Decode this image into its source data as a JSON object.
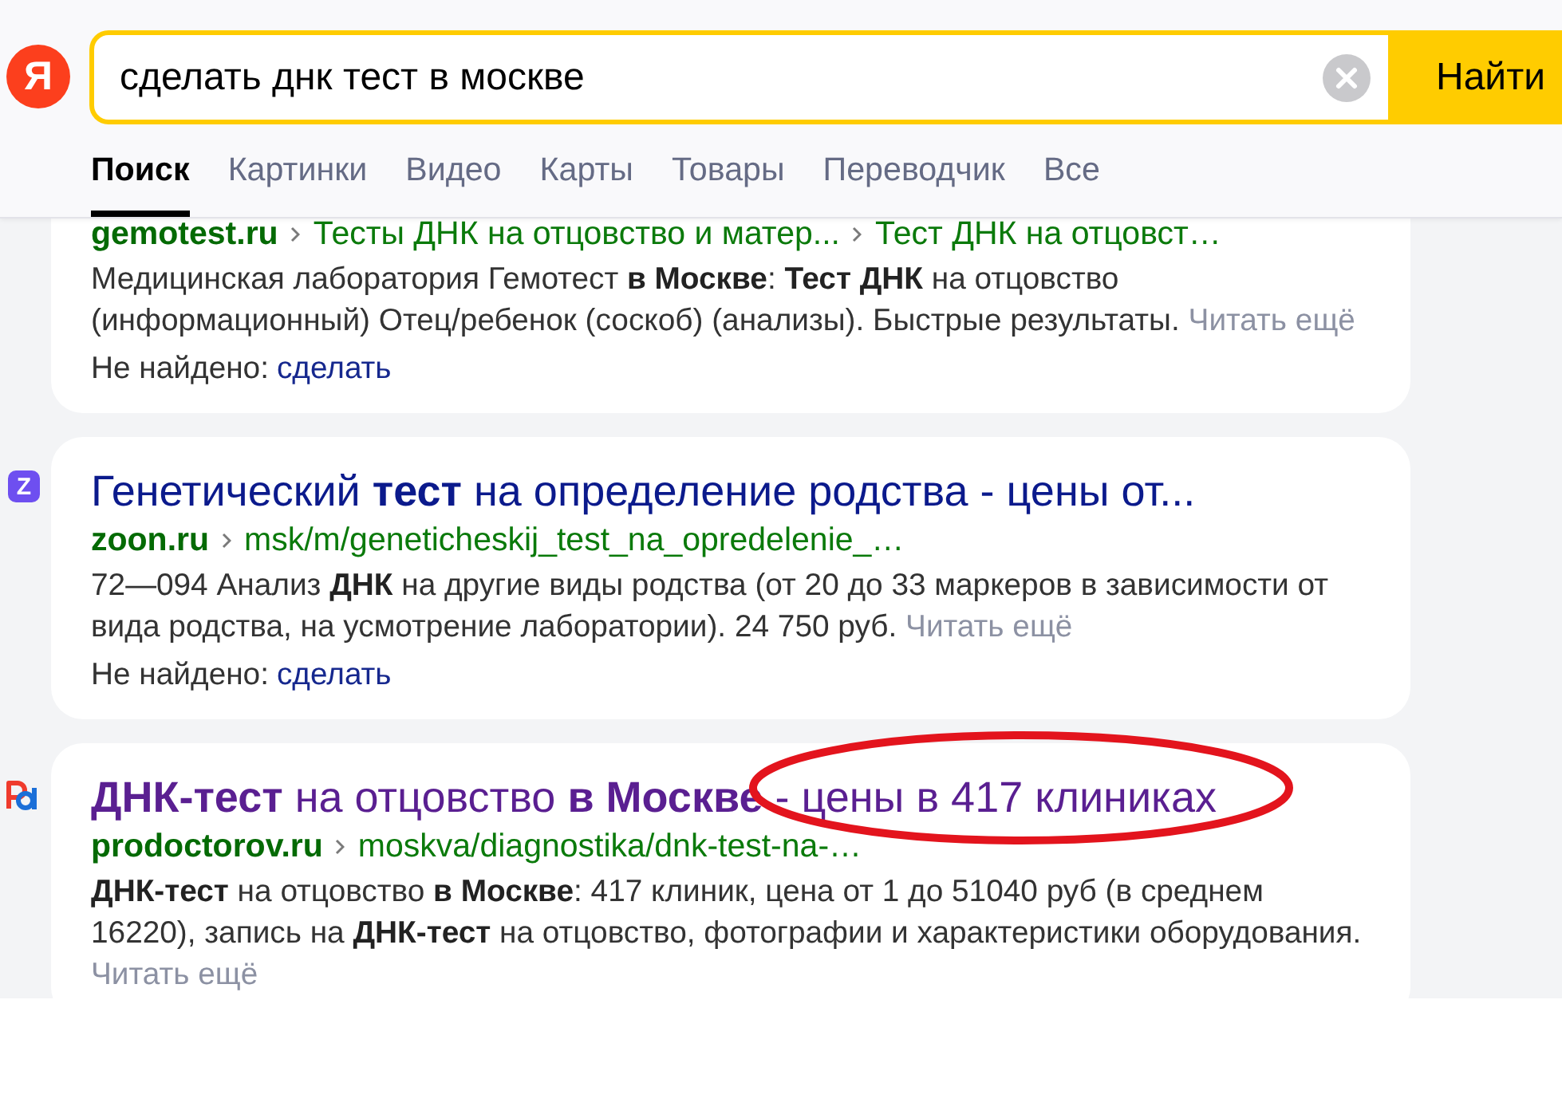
{
  "header": {
    "logo": "Я",
    "search": {
      "value": "сделать днк тест в москве",
      "button": "Найти"
    }
  },
  "tabs": [
    {
      "label": "Поиск",
      "selected": true
    },
    {
      "label": "Картинки",
      "selected": false
    },
    {
      "label": "Видео",
      "selected": false
    },
    {
      "label": "Карты",
      "selected": false
    },
    {
      "label": "Товары",
      "selected": false
    },
    {
      "label": "Переводчик",
      "selected": false
    },
    {
      "label": "Все",
      "selected": false
    }
  ],
  "results": [
    {
      "url": {
        "domain": "gemotest.ru",
        "path": [
          "Тесты ДНК на отцовство и матер...",
          "Тест ДНК на отцовст…"
        ]
      },
      "snippet": "Медицинская лаборатория Гемотест **в Москве**: **Тест ДНК** на отцовство (информационный) Отец/ребенок (соскоб) (анализы). Быстрые результаты.",
      "read_more": "Читать ещё",
      "not_found": {
        "label": "Не найдено:",
        "term": "сделать"
      }
    },
    {
      "favicon": {
        "kind": "letter",
        "text": "Z"
      },
      "title": "Генетический **тест** на определение родства - цены от...",
      "visited": false,
      "url": {
        "domain": "zoon.ru",
        "path": [
          "msk/m/geneticheskij_test_na_opredelenie_…"
        ]
      },
      "snippet": "72—094 Анализ **ДНК** на другие виды родства (от 20 до 33 маркеров в зависимости от вида родства, на усмотрение лаборатории). 24 750 руб.",
      "read_more": "Читать ещё",
      "not_found": {
        "label": "Не найдено:",
        "term": "сделать"
      }
    },
    {
      "favicon": {
        "kind": "mark"
      },
      "title": "**ДНК-тест** на отцовство **в Москве** - цены в 417 клиниках",
      "visited": true,
      "url": {
        "domain": "prodoctorov.ru",
        "path": [
          "moskva/diagnostika/dnk-test-na-…"
        ]
      },
      "snippet": "**ДНК-тест** на отцовство **в Москве**: 417 клиник, цена от 1 до 51040 руб (в среднем 16220), запись на **ДНК-тест** на отцовство, фотографии и характеристики оборудования.",
      "read_more": "Читать ещё",
      "annotation": {
        "kind": "ellipse"
      }
    }
  ]
}
